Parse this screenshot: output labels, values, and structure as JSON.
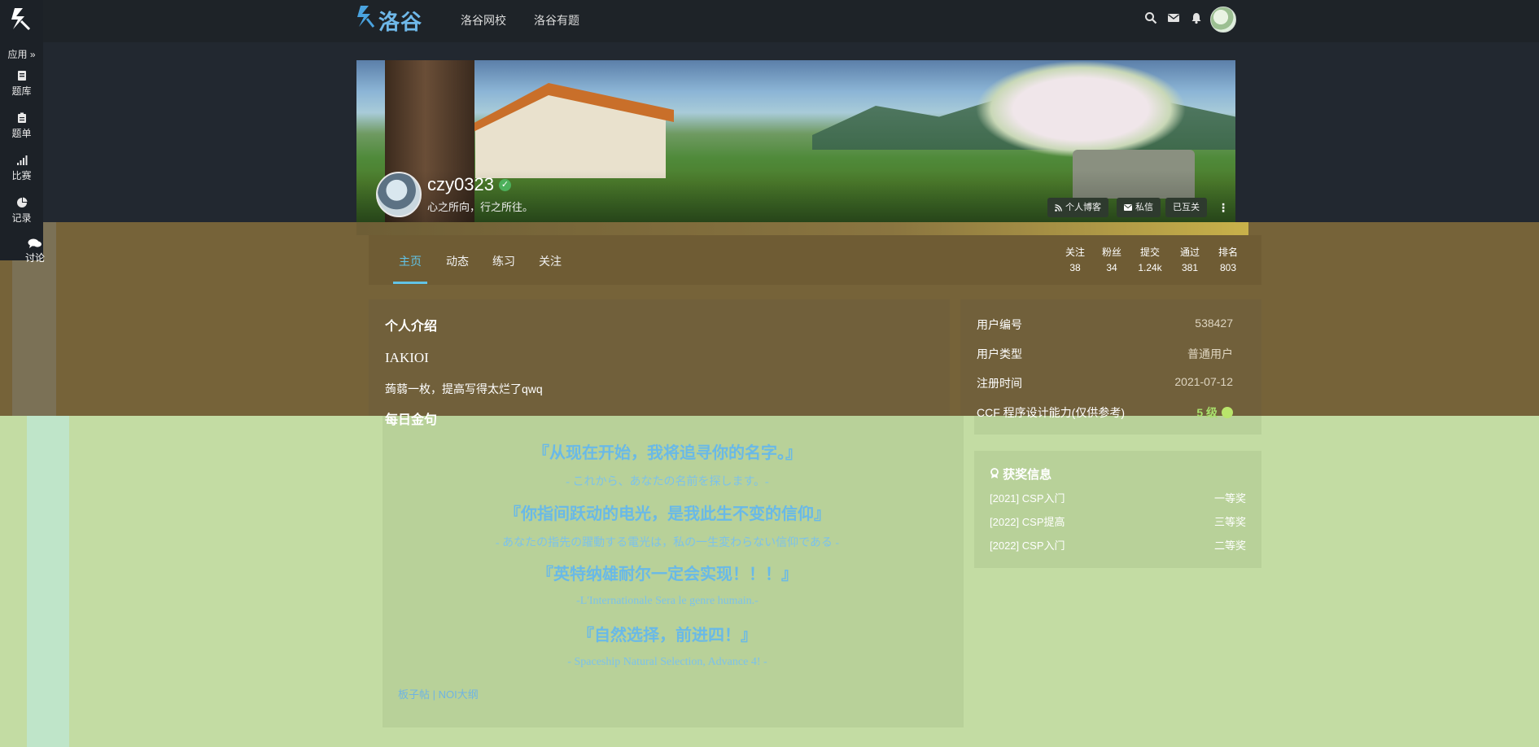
{
  "sidebar": {
    "apps_label": "应用 »",
    "items": [
      {
        "label": "题库"
      },
      {
        "label": "题单"
      },
      {
        "label": "比赛"
      },
      {
        "label": "记录"
      },
      {
        "label": "讨论"
      }
    ]
  },
  "topnav": {
    "logo_text": "洛谷",
    "links": [
      "洛谷网校",
      "洛谷有题"
    ]
  },
  "profile": {
    "username": "czy0323",
    "motto": "心之所向，行之所往。",
    "buttons": {
      "blog": "个人博客",
      "message": "私信",
      "follow": "已互关"
    }
  },
  "tabs": [
    "主页",
    "动态",
    "练习",
    "关注"
  ],
  "stats": [
    {
      "label": "关注",
      "value": "38"
    },
    {
      "label": "粉丝",
      "value": "34"
    },
    {
      "label": "提交",
      "value": "1.24k"
    },
    {
      "label": "通过",
      "value": "381"
    },
    {
      "label": "排名",
      "value": "803"
    }
  ],
  "intro": {
    "title": "个人介绍",
    "heading": "IAKIOI",
    "text": "蒟蒻一枚，提高写得太烂了qwq",
    "daily_title": "每日金句",
    "quotes": [
      {
        "main": "『从现在开始，我将追寻你的名字。』",
        "sub": "- これから、あなたの名前を探します。-"
      },
      {
        "main": "『你指间跃动的电光，是我此生不变的信仰』",
        "sub": "- あなたの指先の躍動する電光は，私の一生変わらない信仰である -"
      },
      {
        "main": "『英特纳雄耐尔一定会实现！！！』",
        "sub": "-L'Internationale Sera le genre humain.-"
      },
      {
        "main": "『自然选择，前进四！』",
        "sub": "- Spaceship Natural Selection, Advance 4! -"
      }
    ],
    "links": "板子帖 | NOI大纲"
  },
  "info": [
    {
      "label": "用户编号",
      "value": "538427"
    },
    {
      "label": "用户类型",
      "value": "普通用户"
    },
    {
      "label": "注册时间",
      "value": "2021-07-12"
    },
    {
      "label": "CCF 程序设计能力(仅供参考)",
      "value": "5 级"
    }
  ],
  "awards": {
    "title": "获奖信息",
    "items": [
      {
        "name": "[2021] CSP入门",
        "level": "一等奖"
      },
      {
        "name": "[2022] CSP提高",
        "level": "三等奖"
      },
      {
        "name": "[2022] CSP入门",
        "level": "二等奖"
      }
    ]
  }
}
